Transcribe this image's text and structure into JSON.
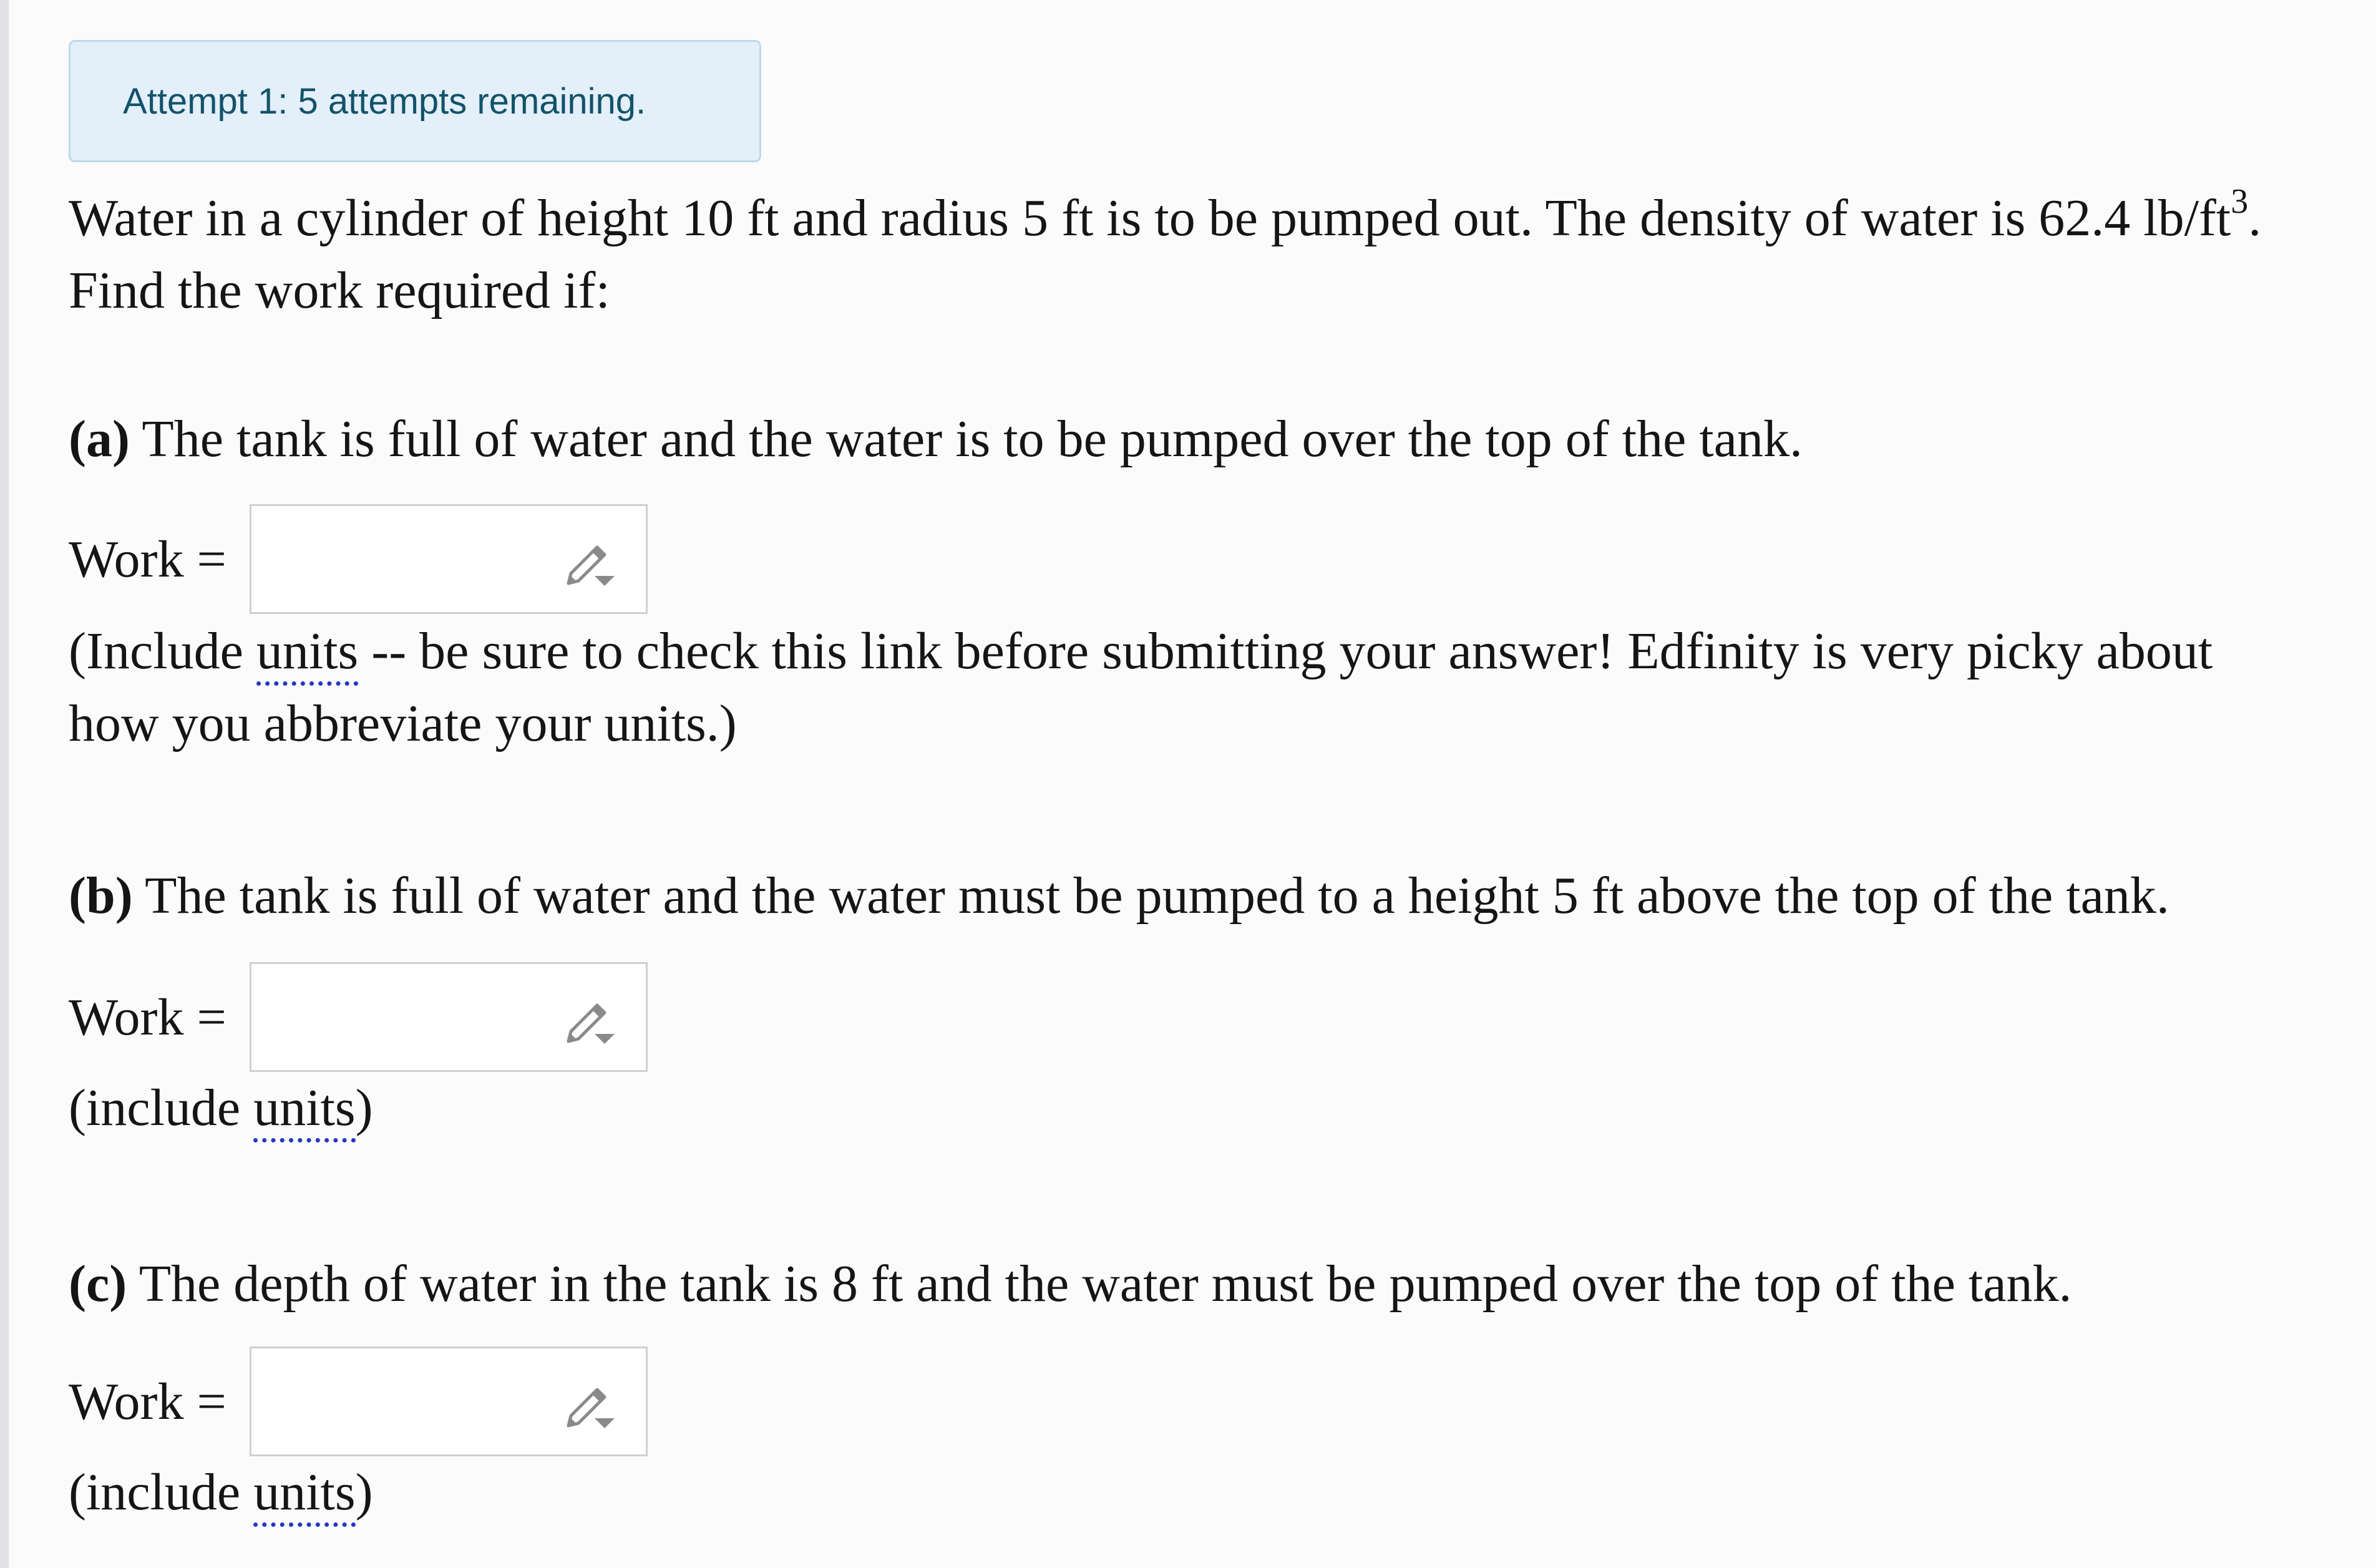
{
  "attempt": {
    "text": "Attempt 1: 5 attempts remaining."
  },
  "problem": {
    "intro_line1_pre": "Water in a cylinder of height 10 ft and radius 5 ft is to be pumped out. The density of water is 62.4 lb/ft",
    "intro_line1_sup": "3",
    "intro_line1_post": ".",
    "intro_line2": "Find the work required if:"
  },
  "parts": {
    "a": {
      "label": "(a)",
      "question": " The tank is full of water and the water is to be pumped over the top of the tank.",
      "work_label": "Work =",
      "answer_value": "",
      "note_pre": "(Include ",
      "note_link": "units",
      "note_post_line1": " -- be sure to check this link before submitting your answer! Edfinity is very picky about",
      "note_line2": "how you abbreviate your units.)"
    },
    "b": {
      "label": "(b)",
      "question": " The tank is full of water and the water must be pumped to a height 5 ft above the top of the tank.",
      "work_label": "Work =",
      "answer_value": "",
      "note_pre": "(include ",
      "note_link": "units",
      "note_post": ")"
    },
    "c": {
      "label": "(c)",
      "question": " The depth of water in the tank is 8 ft and the water must be pumped over the top of the tank.",
      "work_label": "Work =",
      "answer_value": "",
      "note_pre": "(include ",
      "note_link": "units",
      "note_post": ")"
    }
  },
  "icons": {
    "answer_tool": "pencil-dropdown-icon"
  },
  "colors": {
    "banner_bg": "#e3eff9",
    "banner_border": "#bcd9ea",
    "banner_text": "#13536a",
    "link_underline": "#2436c4",
    "icon_gray": "#8a8a8a"
  }
}
